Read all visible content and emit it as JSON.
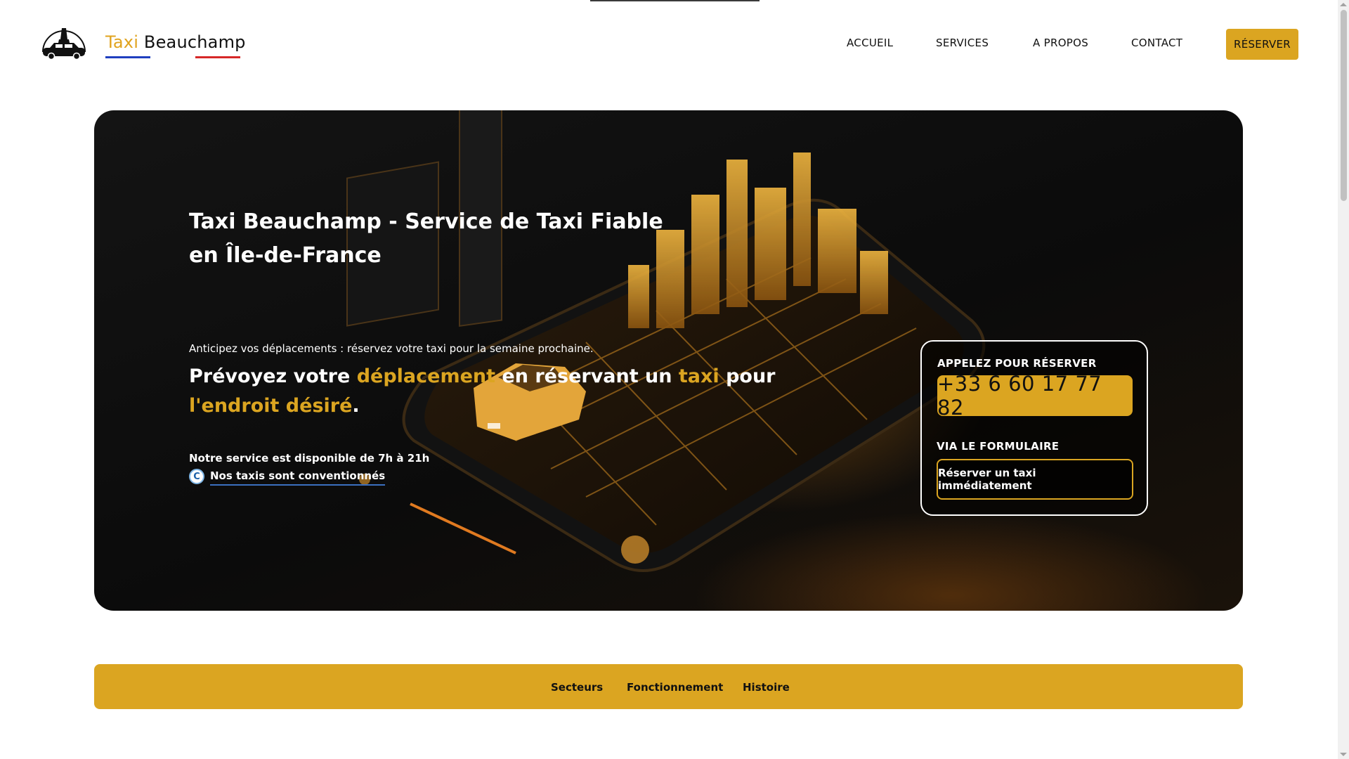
{
  "header": {
    "logo_taxi": "Taxi",
    "logo_name": "Beauchamp",
    "nav": [
      "ACCUEIL",
      "SERVICES",
      "A PROPOS",
      "CONTACT"
    ],
    "reserve_button": "RÉSERVER",
    "tricolore_colors": [
      "#1f3fbf",
      "#ffffff",
      "#d62828"
    ]
  },
  "hero": {
    "title": "Taxi Beauchamp - Service de Taxi Fiable en Île-de-France",
    "small": "Anticipez vos déplacements : réservez votre taxi pour la semaine prochaine.",
    "lead_1": "Prévoyez votre ",
    "lead_hl_1": "déplacement",
    "lead_2": " en réservant un ",
    "lead_hl_2": "taxi",
    "lead_3": " pour ",
    "lead_hl_3": "l'endroit désiré",
    "lead_4": ".",
    "hours": "Notre service est disponible de 7h à 21h",
    "conventionne_icon_letter": "C",
    "conventionne": "Nos taxis sont conventionnés"
  },
  "booking": {
    "call_label": "APPELEZ POUR RÉSERVER",
    "phone": "+33 6 60 17 77 82",
    "form_label": "VIA LE FORMULAIRE",
    "form_button": "Réserver un taxi immédiatement"
  },
  "subnav": [
    "Secteurs",
    "Fonctionnement",
    "Histoire"
  ],
  "colors": {
    "accent": "#dba521",
    "hero_bg": "#0e0e0e"
  },
  "icons": {
    "logo": "eiffel-tower-taxi-logo",
    "conventionne": "conventionne-badge-icon"
  }
}
